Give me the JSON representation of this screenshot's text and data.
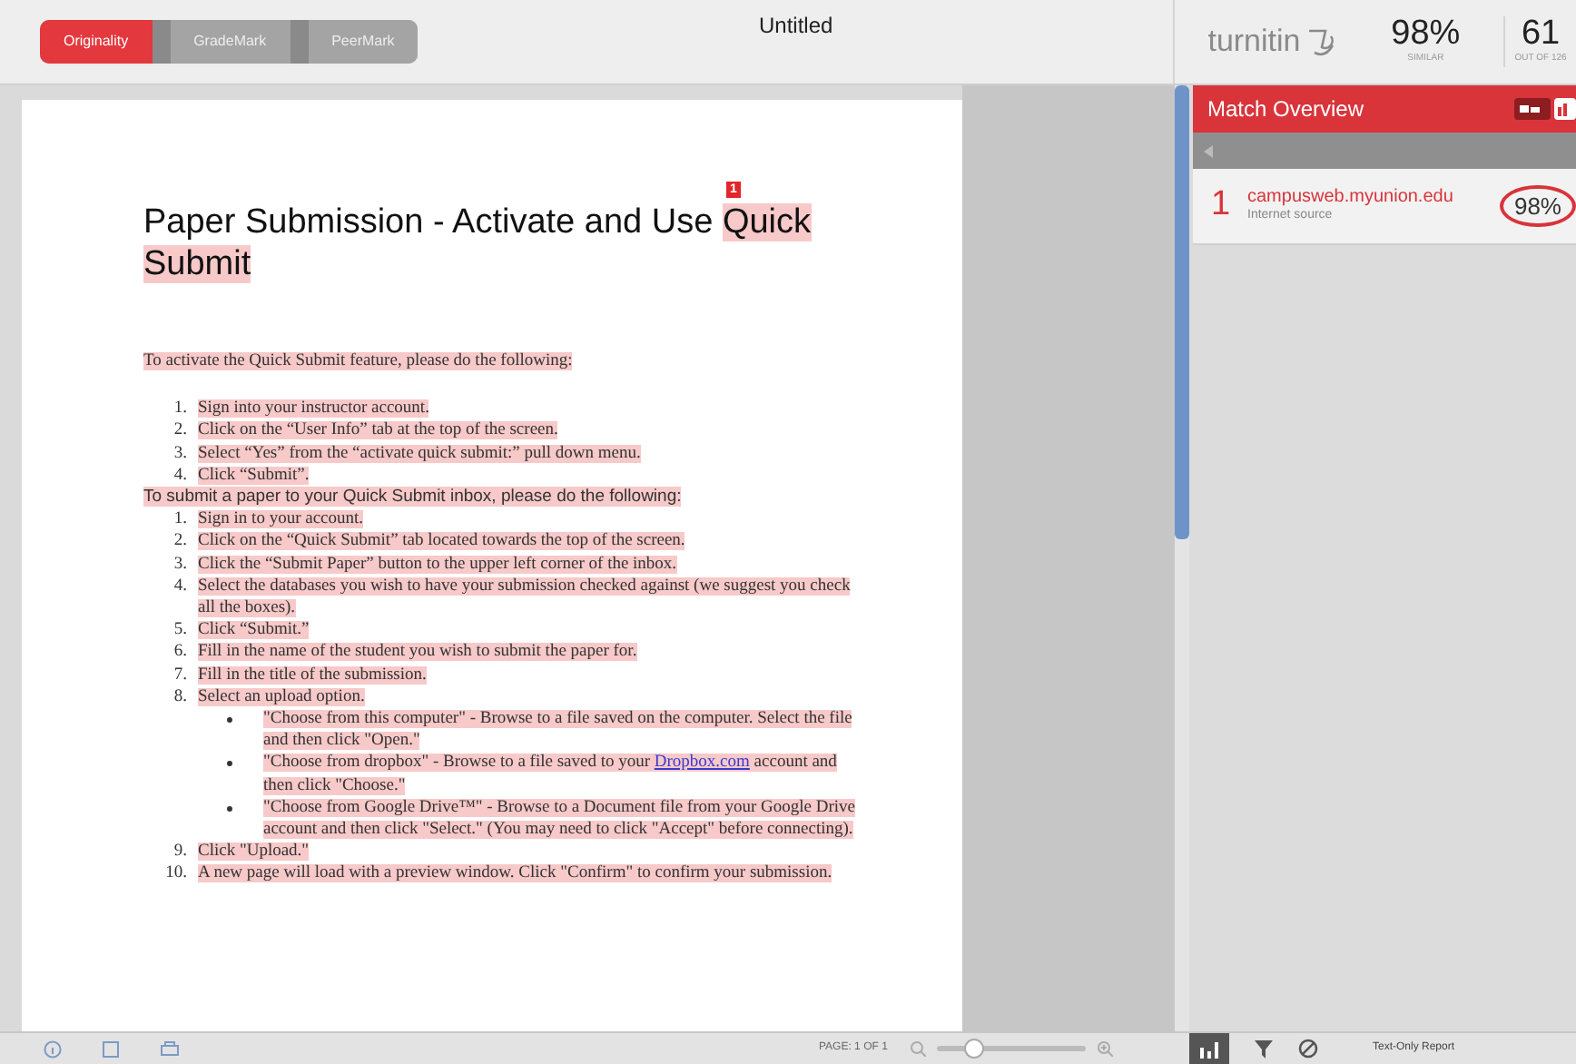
{
  "modes": [
    {
      "label": "Originality",
      "selected": true
    },
    {
      "label": "GradeMark",
      "selected": false
    },
    {
      "label": "PeerMark",
      "selected": false
    }
  ],
  "title": "Untitled",
  "brand": "turnitin",
  "similarity": {
    "value": "98%",
    "caption": "SIMILAR"
  },
  "score": {
    "value": "61",
    "caption": "OUT OF 126"
  },
  "document": {
    "heading": "Paper Submission - Activate and Use ",
    "heading_match": "Quick Submit",
    "match_number": "1",
    "lines": [
      {
        "kind": "para",
        "parts": [
          {
            "text": "To activate the Quick Submit feature, please do the following:"
          }
        ]
      },
      {
        "kind": "ol",
        "number": "1.",
        "parts": [
          {
            "text": "Sign into your instructor account."
          }
        ]
      },
      {
        "kind": "ol",
        "number": "2.",
        "parts": [
          {
            "text": "Click on the “User Info” tab at the top of the screen."
          }
        ]
      },
      {
        "kind": "ol",
        "number": "3.",
        "parts": [
          {
            "text": "Select “Yes” from the “activate quick submit:” pull down menu."
          }
        ]
      },
      {
        "kind": "ol",
        "number": "4.",
        "parts": [
          {
            "text": "Click “Submit”."
          }
        ]
      },
      {
        "kind": "subhead",
        "parts": [
          {
            "text": "To submit a paper to your Quick Submit inbox, please do the following:"
          }
        ]
      },
      {
        "kind": "ol",
        "number": "1.",
        "parts": [
          {
            "text": "Sign in to your account."
          }
        ]
      },
      {
        "kind": "ol",
        "number": "2.",
        "parts": [
          {
            "text": "Click on the “Quick Submit” tab located towards the top of the screen."
          }
        ]
      },
      {
        "kind": "ol",
        "number": "3.",
        "parts": [
          {
            "text": "Click the “Submit Paper” button to the upper left corner of the inbox."
          }
        ]
      },
      {
        "kind": "ol",
        "number": "4.",
        "parts": [
          {
            "text": "Select the databases you wish to have your submission checked against (we suggest you check all the boxes)."
          }
        ]
      },
      {
        "kind": "ol",
        "number": "5.",
        "parts": [
          {
            "text": "Click “Submit.”"
          }
        ]
      },
      {
        "kind": "ol",
        "number": "6.",
        "parts": [
          {
            "text": "Fill in the name of the student you wish to submit the paper for."
          }
        ]
      },
      {
        "kind": "ol",
        "number": "7.",
        "parts": [
          {
            "text": "Fill in the title of the submission."
          }
        ]
      },
      {
        "kind": "ol",
        "number": "8.",
        "parts": [
          {
            "text": "Select an upload option."
          }
        ]
      },
      {
        "kind": "bullet",
        "parts": [
          {
            "text": "\"Choose from this computer\" - Browse to a file saved on the computer. Select the file and then click \"Open.\""
          }
        ]
      },
      {
        "kind": "bullet",
        "parts": [
          {
            "text": "\"Choose from dropbox\" - Browse to a file saved to your "
          },
          {
            "text": "Dropbox.com",
            "link": true
          },
          {
            "text": " account and then click \"Choose.\""
          }
        ]
      },
      {
        "kind": "bullet",
        "parts": [
          {
            "text": "\"Choose from Google Drive™\" - Browse to a Document file from your Google Drive account and then click \"Select.\" (You may need to click \"Accept\" before connecting)."
          }
        ]
      },
      {
        "kind": "ol",
        "number": "9.",
        "parts": [
          {
            "text": "Click \"Upload.\""
          }
        ]
      },
      {
        "kind": "ol",
        "number": "10.",
        "parts": [
          {
            "text": "A new page will load with a preview window. Click \"Confirm\" to confirm your submission."
          }
        ]
      }
    ]
  },
  "match_overview": {
    "title": "Match Overview",
    "matches": [
      {
        "number": "1",
        "source": "campusweb.myunion.edu",
        "type": "Internet source",
        "percent": "98%"
      }
    ]
  },
  "footer": {
    "page": "PAGE: 1 OF 1",
    "zoom": {
      "level": 0.25
    },
    "report": "Text-Only Report"
  }
}
